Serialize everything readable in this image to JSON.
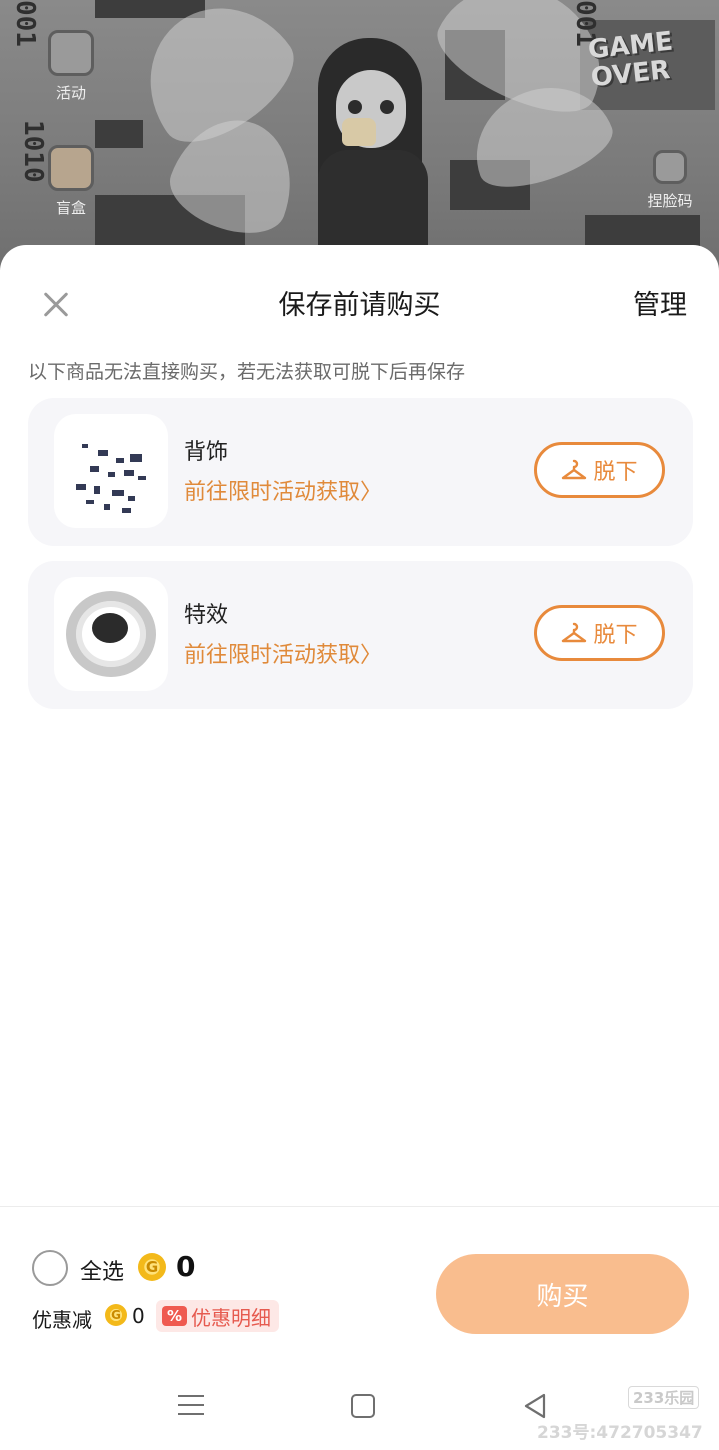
{
  "background_scene": {
    "side_buttons": [
      {
        "label": "活动",
        "icon": "star-icon"
      },
      {
        "label": "盲盒",
        "icon": "gift-box-icon"
      },
      {
        "label": "捏脸码",
        "icon": "edit-code-icon"
      }
    ],
    "poster_text": "GAME OVER"
  },
  "sheet": {
    "title": "保存前请购买",
    "manage_label": "管理",
    "hint": "以下商品无法直接购买，若无法获取可脱下后再保存",
    "items": [
      {
        "name": "背饰",
        "link": "前往限时活动获取〉",
        "action": "脱下",
        "thumb": "back-accessory-thumbnail"
      },
      {
        "name": "特效",
        "link": "前往限时活动获取〉",
        "action": "脱下",
        "thumb": "effect-thumbnail"
      }
    ]
  },
  "footer": {
    "select_all": "全选",
    "total": "0",
    "discount_label": "优惠减",
    "discount_amount": "0",
    "discount_badge": "%",
    "discount_detail": "优惠明细",
    "buy_label": "购买"
  },
  "watermark": {
    "logo": "233乐园",
    "id": "233号:472705347"
  },
  "colors": {
    "accent": "#e88a3c",
    "link": "#e08a3a",
    "buy_button": "#f9bd8e",
    "card_bg": "#f6f6f9",
    "discount": "#ef5a50"
  }
}
